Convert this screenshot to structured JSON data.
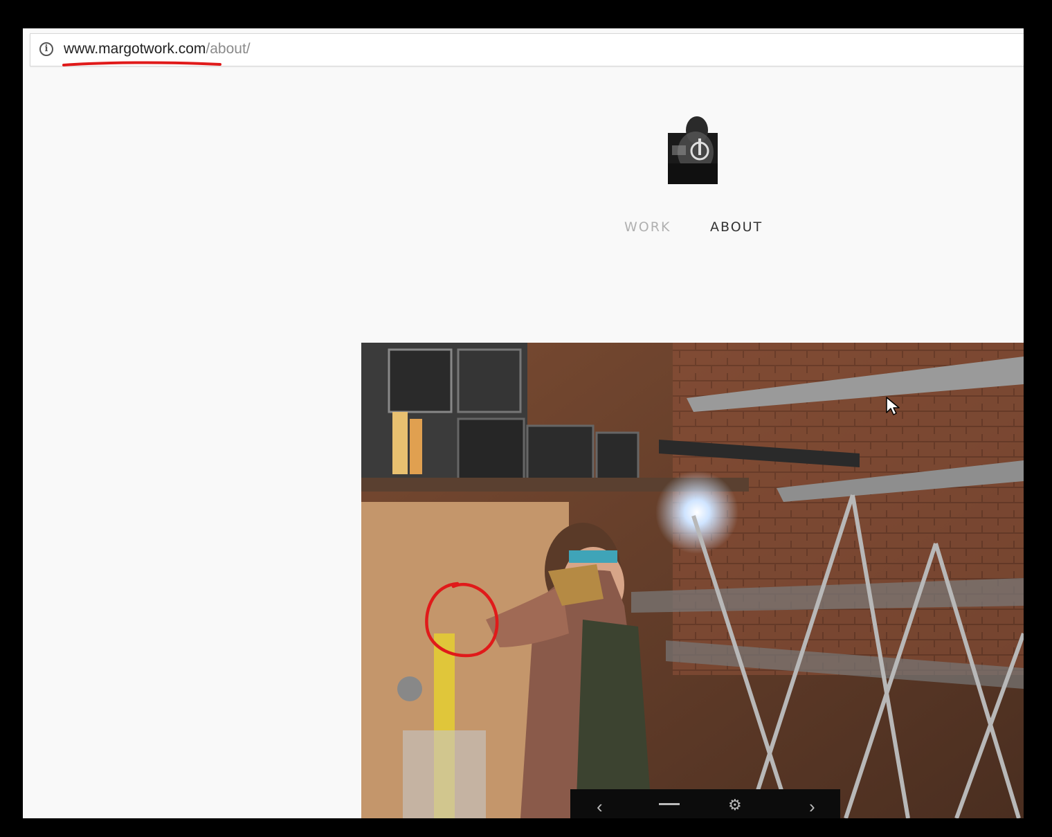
{
  "browser": {
    "url_host": "www.margotwork.com",
    "url_path": "/about/",
    "site_info_icon": "info-icon"
  },
  "site": {
    "logo_icon": "logo-image",
    "nav": [
      {
        "label": "WORK",
        "active": false
      },
      {
        "label": "ABOUT",
        "active": true
      }
    ]
  },
  "hero": {
    "image_icon": "workshop-welding-photo",
    "gallery_controls": [
      "chevron-left-icon",
      "grid-icon",
      "gear-icon",
      "chevron-right-icon"
    ]
  },
  "annotations": {
    "color": "#e01a1a",
    "underline_target": "www.margotwork.com",
    "circle_marker": "circle-annotation"
  },
  "colors": {
    "page_bg": "#f9f9f9",
    "nav_inactive": "#b0b0b0",
    "nav_active": "#333333",
    "frame": "#000000"
  }
}
